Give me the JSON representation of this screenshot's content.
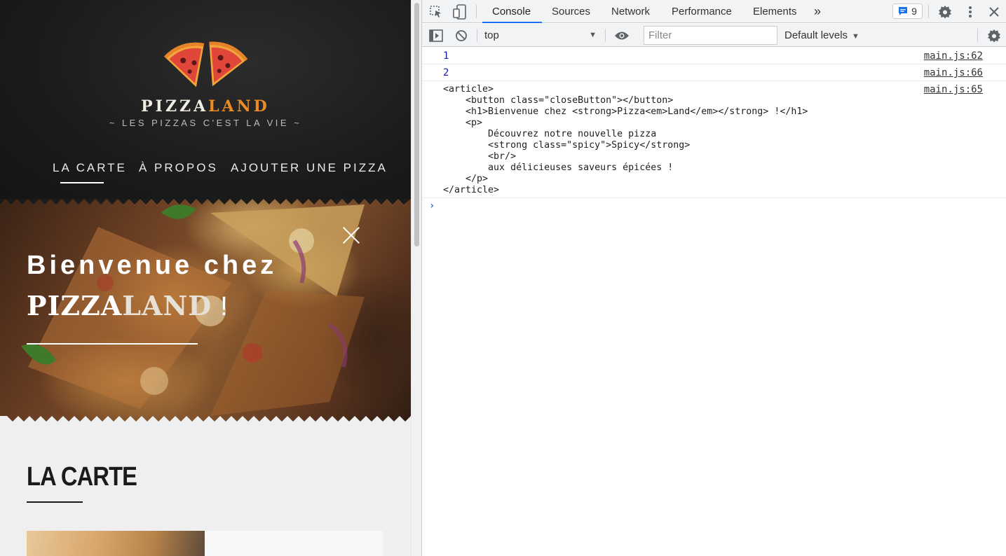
{
  "site": {
    "logo": {
      "part1": "PIZZA",
      "part2": "LAND"
    },
    "tagline": "LES PIZZAS C'EST LA VIE",
    "nav": [
      {
        "label": "LA CARTE"
      },
      {
        "label": "À PROPOS"
      },
      {
        "label": "AJOUTER UNE PIZZA"
      }
    ],
    "hero": {
      "line1": "Bienvenue chez",
      "brand_part1": "PIZZA",
      "brand_part2": "LAND",
      "exclamation": "!"
    },
    "carte": {
      "title": "LA CARTE"
    }
  },
  "devtools": {
    "tabs": [
      {
        "label": "Console"
      },
      {
        "label": "Sources"
      },
      {
        "label": "Network"
      },
      {
        "label": "Performance"
      },
      {
        "label": "Elements"
      }
    ],
    "more_tabs": "»",
    "issues_count": "9",
    "context": "top",
    "filter_placeholder": "Filter",
    "levels": "Default levels",
    "logs": [
      {
        "value": "1",
        "source": "main.js:62"
      },
      {
        "value": "2",
        "source": "main.js:66"
      },
      {
        "source": "main.js:65",
        "code": "<article>\n    <button class=\"closeButton\"></button>\n    <h1>Bienvenue chez <strong>Pizza<em>Land</em></strong> !</h1>\n    <p>\n        Découvrez notre nouvelle pizza\n        <strong class=\"spicy\">Spicy</strong>\n        <br/>\n        aux délicieuses saveurs épicées !\n    </p>\n</article>"
      }
    ],
    "prompt": "›"
  },
  "colors": {
    "brand_orange": "#ec8a23",
    "devtools_accent": "#1a73e8",
    "header_bg": "#1e1e1e"
  }
}
